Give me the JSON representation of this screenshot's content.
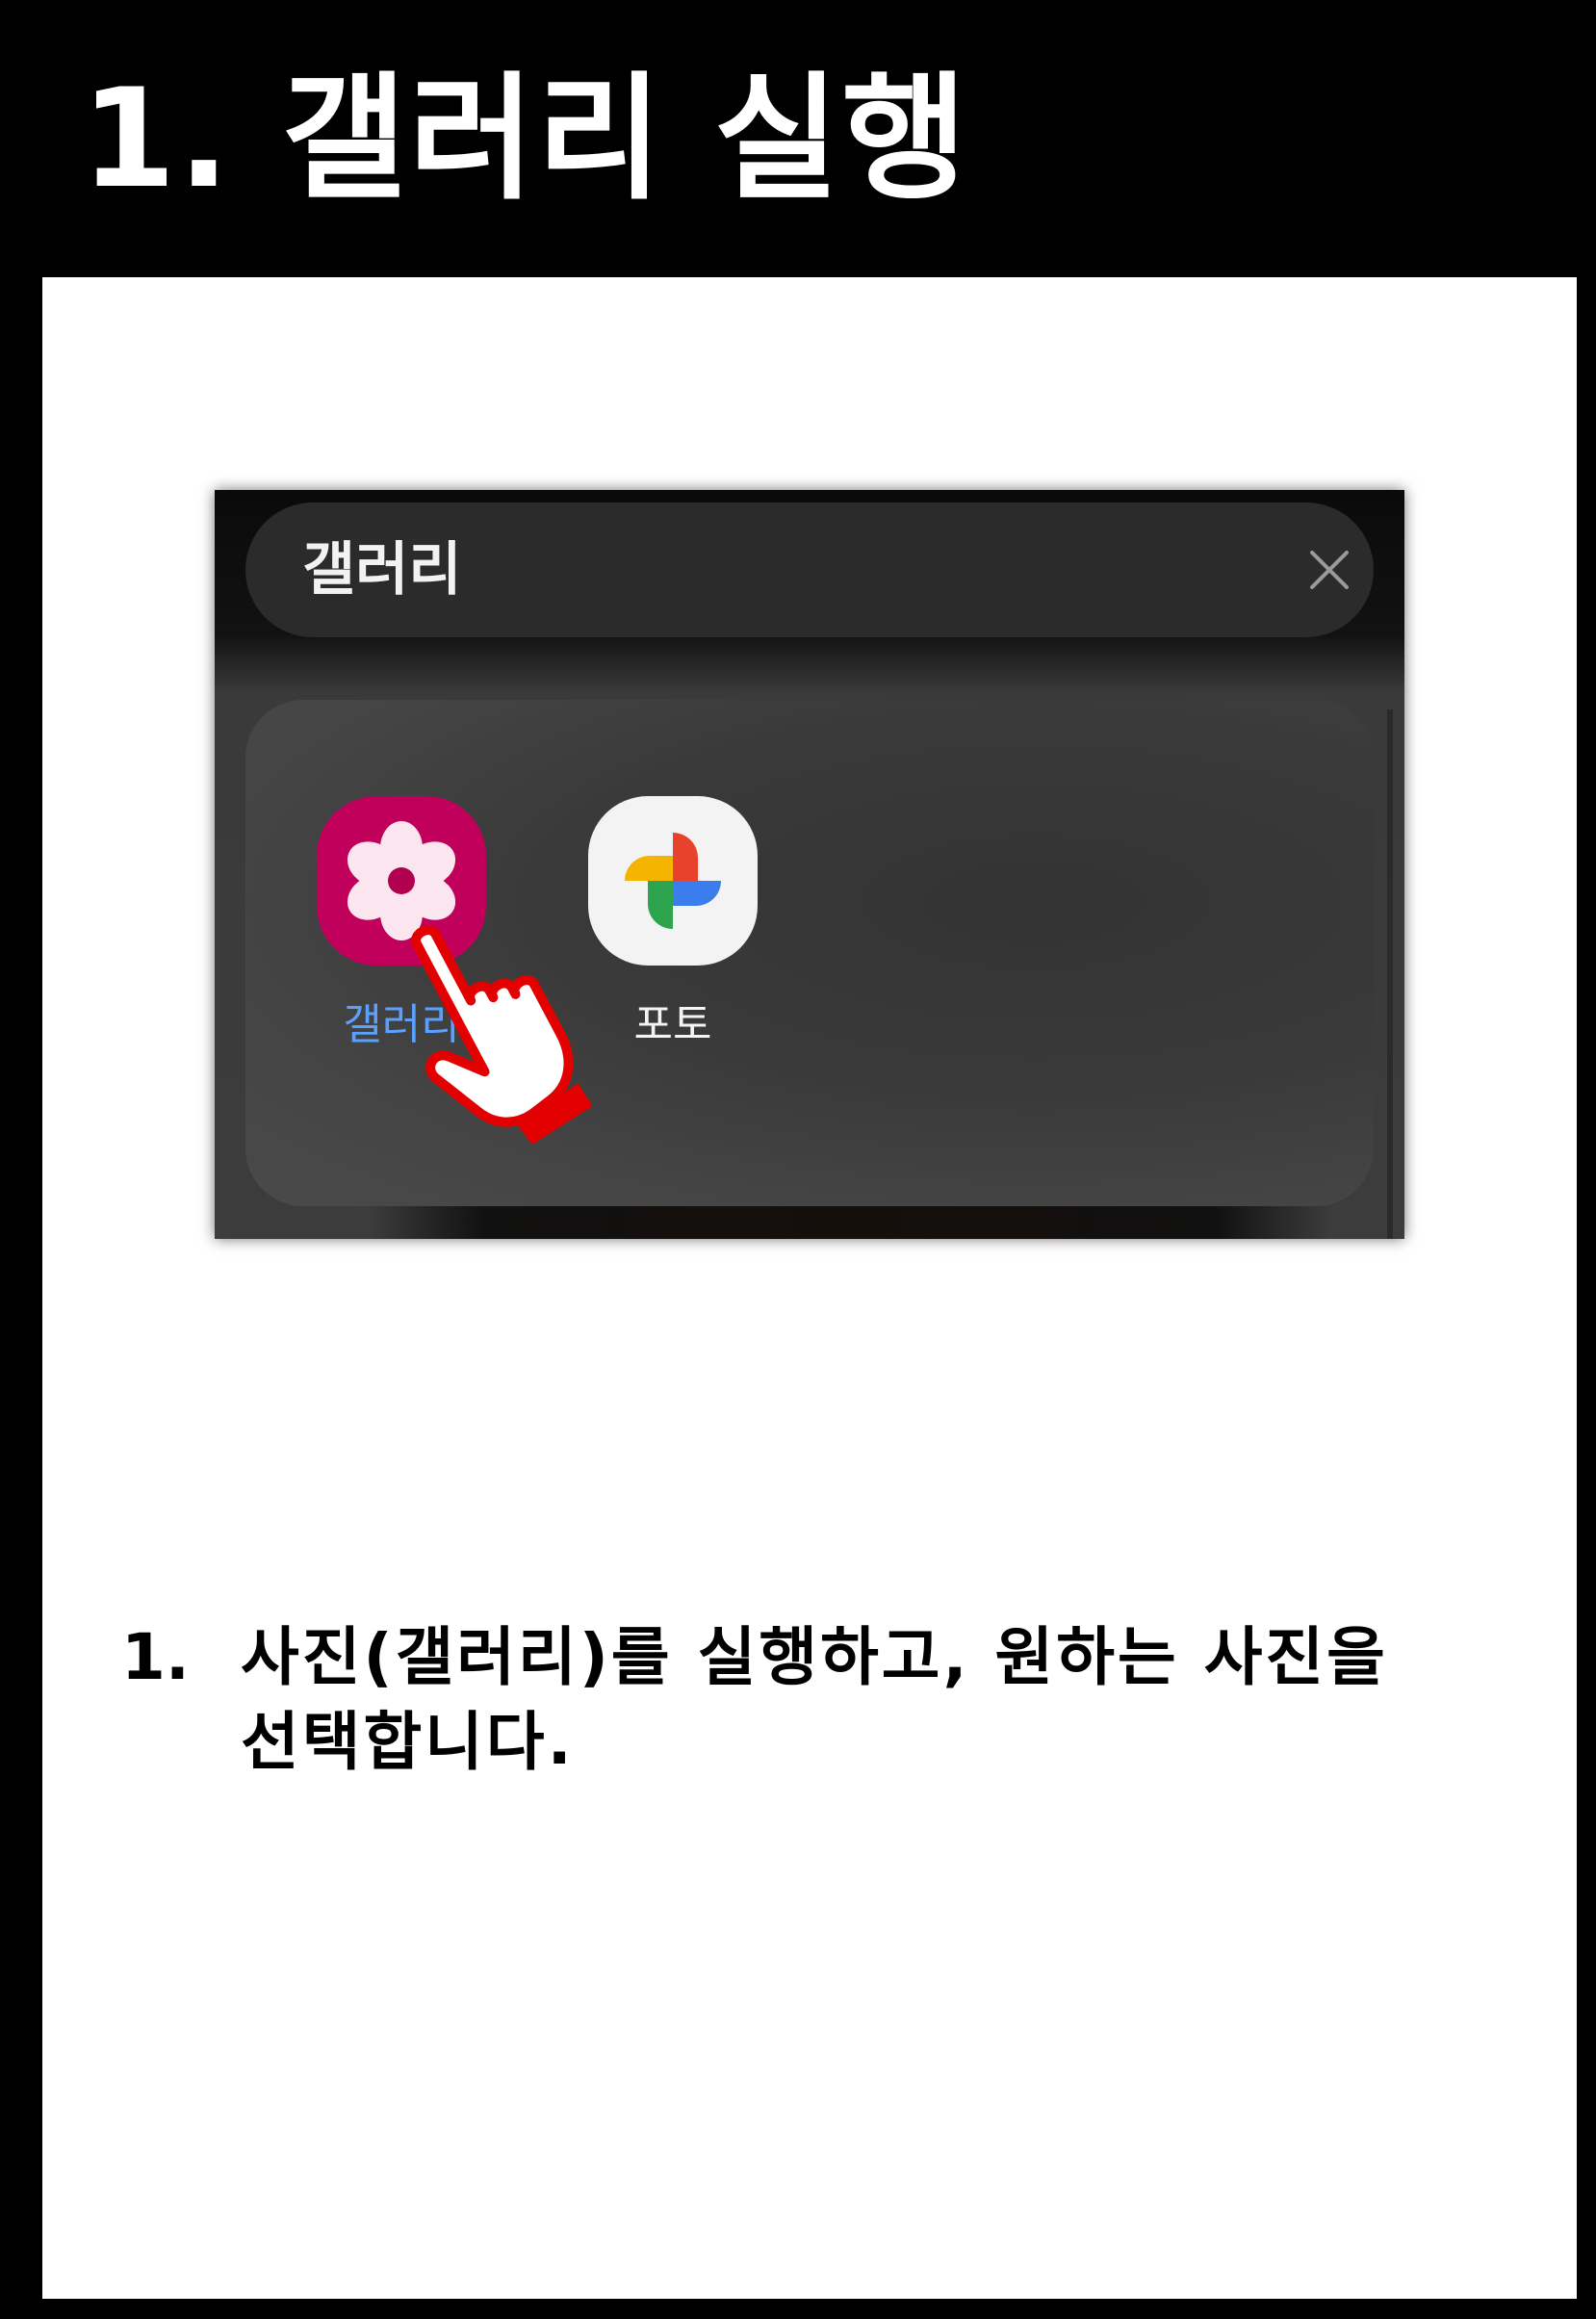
{
  "header": {
    "title": "1. 갤러리 실행"
  },
  "screenshot": {
    "search": {
      "query": "갤러리",
      "close_icon": "close-icon"
    },
    "apps": [
      {
        "label": "갤러리",
        "icon": "gallery-flower-icon",
        "color": "#c0005a",
        "label_color": "#5aa0ff"
      },
      {
        "label": "포토",
        "icon": "google-photos-pinwheel-icon",
        "color": "#f3f3f3",
        "label_color": "#f4f4f4"
      }
    ],
    "pointer": "hand-pointer-icon"
  },
  "instruction": {
    "number": "1.",
    "text": "사진(갤러리)를 실행하고, 원하는 사진을 선택합니다."
  },
  "colors": {
    "frame": "#000000",
    "content_bg": "#ffffff",
    "pointer_outline": "#e30000"
  }
}
